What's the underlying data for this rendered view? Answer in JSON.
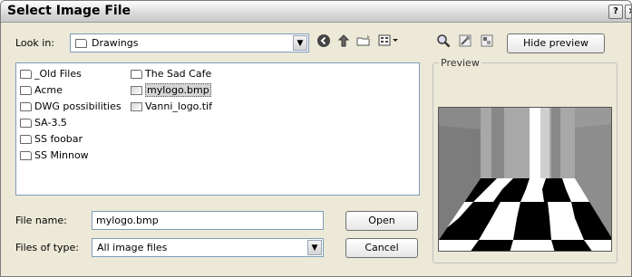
{
  "dialog": {
    "title": "Select Image File",
    "help_button": "?",
    "close_button": "×"
  },
  "look_in": {
    "label": "Look in:",
    "value": "Drawings"
  },
  "toolbar": {
    "back_icon": "back-arrow-icon",
    "up_icon": "up-folder-icon",
    "new_folder_icon": "new-folder-icon",
    "views_icon": "views-menu-icon",
    "zoom_icon": "magnifier-icon",
    "find_icon": "find-icon",
    "tools_icon": "tools-icon",
    "hide_preview_label": "Hide preview"
  },
  "files": [
    {
      "name": "_Old Files",
      "type": "folder"
    },
    {
      "name": "Acme",
      "type": "folder"
    },
    {
      "name": "DWG possibilities",
      "type": "folder"
    },
    {
      "name": "SA-3.5",
      "type": "folder"
    },
    {
      "name": "SS foobar",
      "type": "folder"
    },
    {
      "name": "SS Minnow",
      "type": "folder"
    },
    {
      "name": "The Sad Cafe",
      "type": "folder"
    },
    {
      "name": "mylogo.bmp",
      "type": "file",
      "selected": true
    },
    {
      "name": "Vanni_logo.tif",
      "type": "file"
    }
  ],
  "file_name": {
    "label": "File name:",
    "value": "mylogo.bmp"
  },
  "file_type": {
    "label": "Files of type:",
    "value": "All image files"
  },
  "buttons": {
    "open": "Open",
    "cancel": "Cancel"
  },
  "preview": {
    "label": "Preview"
  }
}
